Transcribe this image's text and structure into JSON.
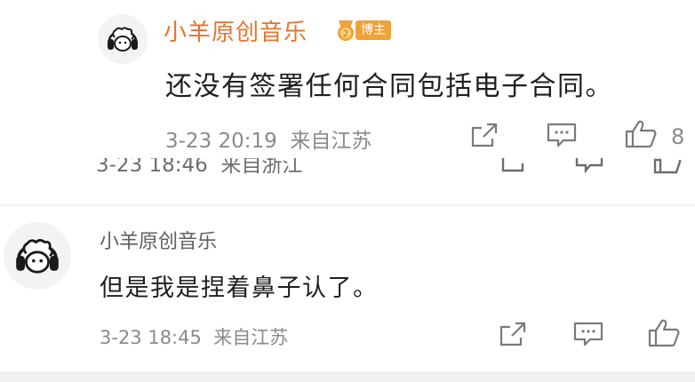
{
  "reply_top": {
    "username": "小羊原创音乐",
    "badge_label": "博主",
    "text": "还没有签署任何合同包括电子合同。",
    "timestamp": "3-23 20:19",
    "location": "来自江苏",
    "like_count": "8"
  },
  "ghost_row": {
    "timestamp": "3-23 18:46",
    "location": "来自浙江"
  },
  "reply_bottom": {
    "username": "小羊原创音乐",
    "text": "但是我是捏着鼻子认了。",
    "timestamp": "3-23 18:45",
    "location": "来自江苏"
  },
  "colors": {
    "username_accent": "#e8722e",
    "badge": "#f0a236",
    "meta_text": "#8a8a8a",
    "icon_stroke": "#7a7a7a"
  },
  "icons": [
    "avatar-sheep-headphones",
    "share-icon",
    "comment-icon",
    "like-icon",
    "vip-medal-icon"
  ]
}
